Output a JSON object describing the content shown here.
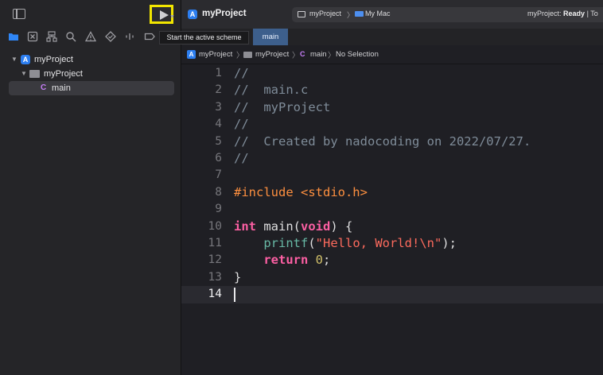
{
  "tooltip": {
    "text": "Start the active scheme"
  },
  "toolbar": {
    "project_title": "myProject",
    "scheme": "myProject",
    "destination": "My Mac",
    "status_project": "myProject:",
    "status_state": "Ready",
    "status_tail": "| To"
  },
  "tabs": [
    {
      "label": "main"
    }
  ],
  "navigator": {
    "items": [
      {
        "label": "myProject",
        "icon": "xcode-project-icon"
      },
      {
        "label": "myProject",
        "icon": "folder-icon"
      },
      {
        "label": "main",
        "icon": "c-file-icon",
        "badge": "C"
      }
    ],
    "tab_icons": [
      "folder-icon",
      "source-control-icon",
      "hierarchy-icon",
      "search-icon",
      "warning-icon",
      "test-icon",
      "breakpoint-icon"
    ]
  },
  "jump_bar": {
    "items": [
      "myProject",
      "myProject",
      "main",
      "No Selection"
    ],
    "c_badge": "C"
  },
  "editor": {
    "current_line": 14,
    "lines": [
      {
        "n": "1",
        "parts": [
          [
            "cmt",
            "//"
          ]
        ]
      },
      {
        "n": "2",
        "parts": [
          [
            "cmt",
            "//  main.c"
          ]
        ]
      },
      {
        "n": "3",
        "parts": [
          [
            "cmt",
            "//  myProject"
          ]
        ]
      },
      {
        "n": "4",
        "parts": [
          [
            "cmt",
            "//"
          ]
        ]
      },
      {
        "n": "5",
        "parts": [
          [
            "cmt",
            "//  Created by nadocoding on 2022/07/27."
          ]
        ]
      },
      {
        "n": "6",
        "parts": [
          [
            "cmt",
            "//"
          ]
        ]
      },
      {
        "n": "7",
        "parts": []
      },
      {
        "n": "8",
        "parts": [
          [
            "pp",
            "#include <stdio.h>"
          ]
        ]
      },
      {
        "n": "9",
        "parts": []
      },
      {
        "n": "10",
        "parts": [
          [
            "kw",
            "int"
          ],
          [
            "plain",
            " main("
          ],
          [
            "kw",
            "void"
          ],
          [
            "plain",
            ") {"
          ]
        ]
      },
      {
        "n": "11",
        "parts": [
          [
            "plain",
            "    "
          ],
          [
            "fn",
            "printf"
          ],
          [
            "plain",
            "("
          ],
          [
            "str",
            "\"Hello, World!\\n\""
          ],
          [
            "plain",
            ");"
          ]
        ]
      },
      {
        "n": "12",
        "parts": [
          [
            "plain",
            "    "
          ],
          [
            "kw",
            "return"
          ],
          [
            "plain",
            " "
          ],
          [
            "num",
            "0"
          ],
          [
            "plain",
            ";"
          ]
        ]
      },
      {
        "n": "13",
        "parts": [
          [
            "plain",
            "}"
          ]
        ]
      },
      {
        "n": "14",
        "parts": []
      }
    ]
  },
  "colors": {
    "highlight": "#f2e600",
    "keyword": "#fc5fa3",
    "string": "#fc6a5d",
    "comment": "#7f8c99",
    "preprocessor": "#fd8f3f",
    "accent": "#2c7ef0"
  }
}
